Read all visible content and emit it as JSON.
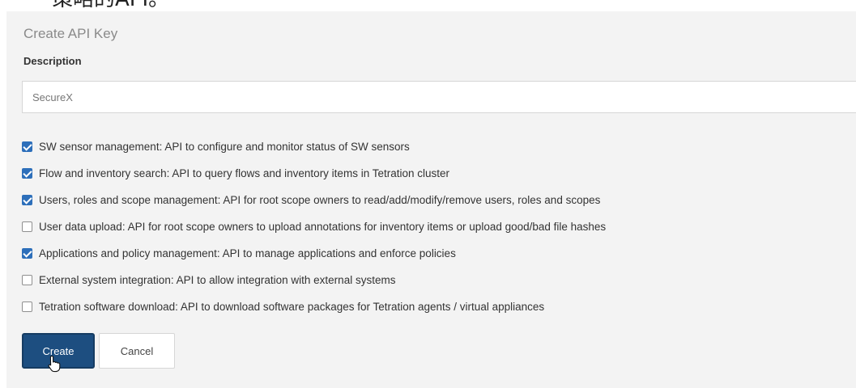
{
  "header_fragment": "策略的API。",
  "dialog": {
    "title": "Create API Key",
    "description_label": "Description",
    "description_value": "SecureX"
  },
  "permissions": [
    {
      "label": "SW sensor management: API to configure and monitor status of SW sensors",
      "checked": true
    },
    {
      "label": "Flow and inventory search: API to query flows and inventory items in Tetration cluster",
      "checked": true
    },
    {
      "label": "Users, roles and scope management: API for root scope owners to read/add/modify/remove users, roles and scopes",
      "checked": true
    },
    {
      "label": "User data upload: API for root scope owners to upload annotations for inventory items or upload good/bad file hashes",
      "checked": false
    },
    {
      "label": "Applications and policy management: API to manage applications and enforce policies",
      "checked": true
    },
    {
      "label": "External system integration: API to allow integration with external systems",
      "checked": false
    },
    {
      "label": "Tetration software download: API to download software packages for Tetration agents / virtual appliances",
      "checked": false
    }
  ],
  "buttons": {
    "create_label": "Create",
    "cancel_label": "Cancel"
  },
  "colors": {
    "accent": "#2d6fba",
    "primary_button": "#1d4e80",
    "panel_background": "#f3f3f3"
  },
  "icons": {
    "cursor": "hand-pointer-icon"
  }
}
